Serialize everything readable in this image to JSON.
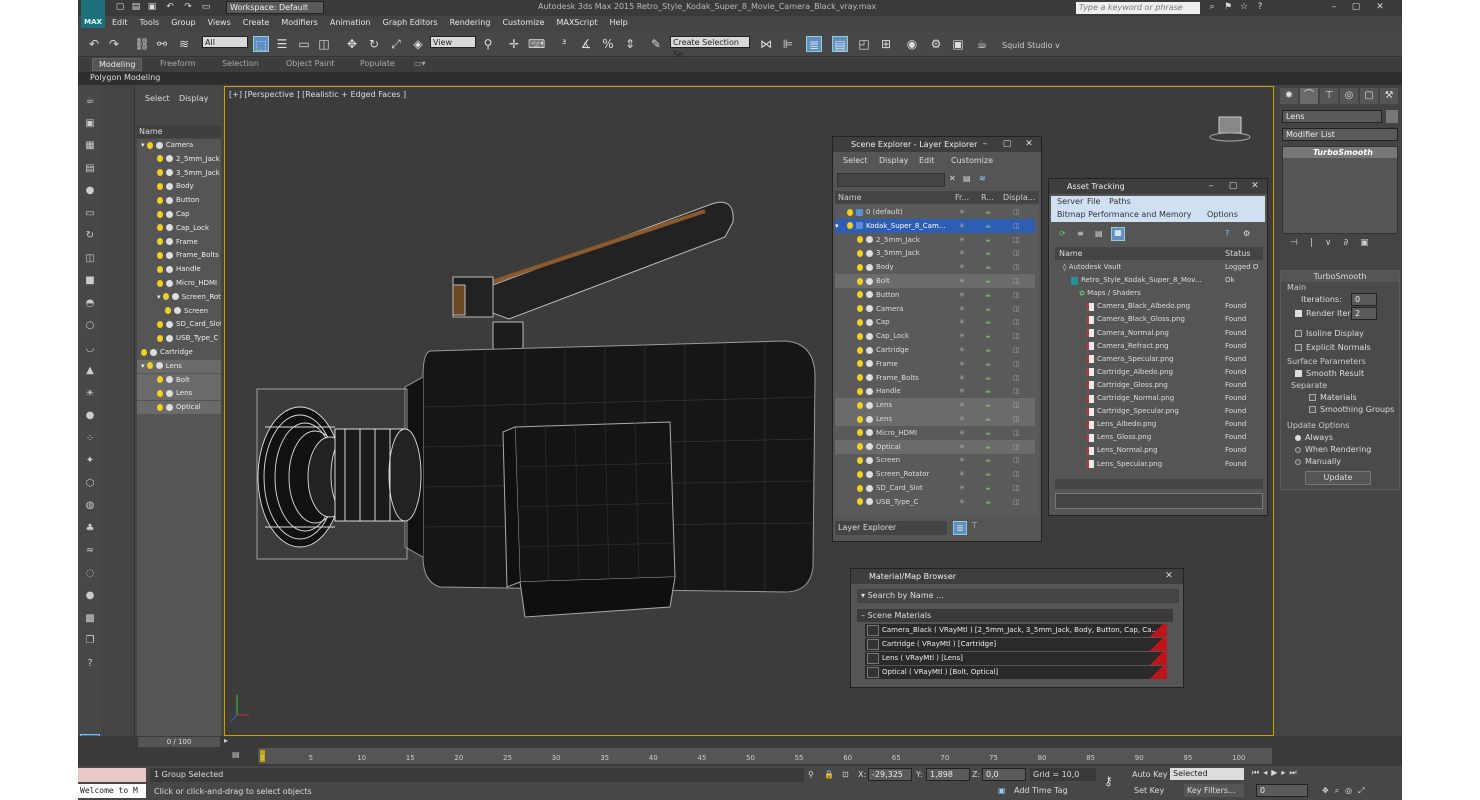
{
  "app": {
    "workspace": "Workspace: Default",
    "title": "Autodesk 3ds Max 2015    Retro_Style_Kodak_Super_8_Movie_Camera_Black_vray.max",
    "search_placeholder": "Type a keyword or phrase",
    "logo": "MAX"
  },
  "menu": [
    "Edit",
    "Tools",
    "Group",
    "Views",
    "Create",
    "Modifiers",
    "Animation",
    "Graph Editors",
    "Rendering",
    "Customize",
    "MAXScript",
    "Help"
  ],
  "toolbar": {
    "filter": "All",
    "view": "View",
    "selection_set": "Create Selection Se",
    "studio": "Squid Studio v"
  },
  "ribbon": {
    "tabs": [
      "Modeling",
      "Freeform",
      "Selection",
      "Object Paint",
      "Populate"
    ],
    "sub": "Polygon Modeling"
  },
  "explorer": {
    "select": "Select",
    "display": "Display",
    "header": "Name",
    "rows": [
      {
        "label": "Camera",
        "kind": "group",
        "indent": 0,
        "sel": false
      },
      {
        "label": "2_5mm_Jack",
        "kind": "obj",
        "indent": 2,
        "sel": false
      },
      {
        "label": "3_5mm_Jack",
        "kind": "obj",
        "indent": 2,
        "sel": false
      },
      {
        "label": "Body",
        "kind": "obj",
        "indent": 2,
        "sel": false
      },
      {
        "label": "Button",
        "kind": "obj",
        "indent": 2,
        "sel": false
      },
      {
        "label": "Cap",
        "kind": "obj",
        "indent": 2,
        "sel": false
      },
      {
        "label": "Cap_Lock",
        "kind": "obj",
        "indent": 2,
        "sel": false
      },
      {
        "label": "Frame",
        "kind": "obj",
        "indent": 2,
        "sel": false
      },
      {
        "label": "Frame_Bolts",
        "kind": "obj",
        "indent": 2,
        "sel": false
      },
      {
        "label": "Handle",
        "kind": "obj",
        "indent": 2,
        "sel": false
      },
      {
        "label": "Micro_HDMI",
        "kind": "obj",
        "indent": 2,
        "sel": false
      },
      {
        "label": "Screen_Rotator",
        "kind": "group",
        "indent": 2,
        "sel": false
      },
      {
        "label": "Screen",
        "kind": "obj",
        "indent": 3,
        "sel": false
      },
      {
        "label": "SD_Card_Slot",
        "kind": "obj",
        "indent": 2,
        "sel": false
      },
      {
        "label": "USB_Type_C",
        "kind": "obj",
        "indent": 2,
        "sel": false
      },
      {
        "label": "Cartridge",
        "kind": "obj",
        "indent": 0,
        "sel": false
      },
      {
        "label": "Lens",
        "kind": "group",
        "indent": 0,
        "sel": true
      },
      {
        "label": "Bolt",
        "kind": "obj",
        "indent": 2,
        "sel": true
      },
      {
        "label": "Lens",
        "kind": "obj",
        "indent": 2,
        "sel": true
      },
      {
        "label": "Optical",
        "kind": "obj",
        "indent": 2,
        "sel": true
      }
    ]
  },
  "viewport": {
    "label": "[+] [Perspective ] [Realistic + Edged Faces ]"
  },
  "scene_explorer": {
    "title": "Scene Explorer - Layer Explorer",
    "menu": [
      "Select",
      "Display",
      "Edit",
      "Customize"
    ],
    "col_name": "Name",
    "col_fr": "Fr...",
    "col_r": "R...",
    "col_disp": "Displa...",
    "rows": [
      {
        "label": "0 (default)",
        "indent": 0,
        "style": ""
      },
      {
        "label": "Kodak_Super_8_Cam...",
        "indent": 0,
        "style": "sel"
      },
      {
        "label": "2_5mm_Jack",
        "indent": 1,
        "style": ""
      },
      {
        "label": "3_5mm_Jack",
        "indent": 1,
        "style": ""
      },
      {
        "label": "Body",
        "indent": 1,
        "style": ""
      },
      {
        "label": "Bolt",
        "indent": 1,
        "style": "hl"
      },
      {
        "label": "Button",
        "indent": 1,
        "style": ""
      },
      {
        "label": "Camera",
        "indent": 1,
        "style": ""
      },
      {
        "label": "Cap",
        "indent": 1,
        "style": ""
      },
      {
        "label": "Cap_Lock",
        "indent": 1,
        "style": ""
      },
      {
        "label": "Cartridge",
        "indent": 1,
        "style": ""
      },
      {
        "label": "Frame",
        "indent": 1,
        "style": ""
      },
      {
        "label": "Frame_Bolts",
        "indent": 1,
        "style": ""
      },
      {
        "label": "Handle",
        "indent": 1,
        "style": ""
      },
      {
        "label": "Lens",
        "indent": 1,
        "style": "hl"
      },
      {
        "label": "Lens",
        "indent": 1,
        "style": "hl"
      },
      {
        "label": "Micro_HDMI",
        "indent": 1,
        "style": ""
      },
      {
        "label": "Optical",
        "indent": 1,
        "style": "hl"
      },
      {
        "label": "Screen",
        "indent": 1,
        "style": ""
      },
      {
        "label": "Screen_Rotator",
        "indent": 1,
        "style": ""
      },
      {
        "label": "SD_Card_Slot",
        "indent": 1,
        "style": ""
      },
      {
        "label": "USB_Type_C",
        "indent": 1,
        "style": ""
      }
    ],
    "footer": "Layer Explorer"
  },
  "asset_tracking": {
    "title": "Asset Tracking",
    "menu1": [
      "Server",
      "File",
      "Paths"
    ],
    "menu2": [
      "Bitmap Performance and Memory",
      "Options"
    ],
    "col_name": "Name",
    "col_status": "Status",
    "rows": [
      {
        "label": "Autodesk Vault",
        "status": "Logged O",
        "indent": 1,
        "type": "vault"
      },
      {
        "label": "Retro_Style_Kodak_Super_8_Mov...",
        "status": "Ok",
        "indent": 2,
        "type": "max"
      },
      {
        "label": "Maps / Shaders",
        "status": "",
        "indent": 3,
        "type": "maps"
      },
      {
        "label": "Camera_Black_Albedo.png",
        "status": "Found",
        "indent": 4,
        "type": "file"
      },
      {
        "label": "Camera_Black_Gloss.png",
        "status": "Found",
        "indent": 4,
        "type": "file"
      },
      {
        "label": "Camera_Normal.png",
        "status": "Found",
        "indent": 4,
        "type": "file"
      },
      {
        "label": "Camera_Refract.png",
        "status": "Found",
        "indent": 4,
        "type": "file"
      },
      {
        "label": "Camera_Specular.png",
        "status": "Found",
        "indent": 4,
        "type": "file"
      },
      {
        "label": "Cartridge_Albedo.png",
        "status": "Found",
        "indent": 4,
        "type": "file"
      },
      {
        "label": "Cartridge_Gloss.png",
        "status": "Found",
        "indent": 4,
        "type": "file"
      },
      {
        "label": "Cartridge_Normal.png",
        "status": "Found",
        "indent": 4,
        "type": "file"
      },
      {
        "label": "Cartridge_Specular.png",
        "status": "Found",
        "indent": 4,
        "type": "file"
      },
      {
        "label": "Lens_Albedo.png",
        "status": "Found",
        "indent": 4,
        "type": "file"
      },
      {
        "label": "Lens_Gloss.png",
        "status": "Found",
        "indent": 4,
        "type": "file"
      },
      {
        "label": "Lens_Normal.png",
        "status": "Found",
        "indent": 4,
        "type": "file"
      },
      {
        "label": "Lens_Specular.png",
        "status": "Found",
        "indent": 4,
        "type": "file"
      }
    ]
  },
  "material_browser": {
    "title": "Material/Map Browser",
    "search": "Search by Name ...",
    "section": "Scene Materials",
    "rows": [
      "Camera_Black  ( VRayMtl )  [2_5mm_Jack, 3_5mm_Jack, Body, Button, Cap, Ca...",
      "Cartridge  ( VRayMtl )  [Cartridge]",
      "Lens  ( VRayMtl )  [Lens]",
      "Optical  ( VRayMtl )  [Bolt, Optical]"
    ]
  },
  "command_panel": {
    "object_name": "Lens",
    "modifier_list": "Modifier List",
    "stack_item": "TurboSmooth",
    "rollout_title": "TurboSmooth",
    "main": "Main",
    "iterations_label": "Iterations:",
    "iterations": "0",
    "render_iters_label": "Render Iters:",
    "render_iters": "2",
    "isoline": "Isoline Display",
    "explicit": "Explicit Normals",
    "surface": "Surface Parameters",
    "smooth_result": "Smooth Result",
    "separate": "Separate",
    "materials": "Materials",
    "smoothing_groups": "Smoothing Groups",
    "update_options": "Update Options",
    "always": "Always",
    "when_rendering": "When Rendering",
    "manually": "Manually",
    "update": "Update"
  },
  "timeline": {
    "frame": "0 / 100",
    "ticks": [
      "0",
      "5",
      "10",
      "15",
      "20",
      "25",
      "30",
      "35",
      "40",
      "45",
      "50",
      "55",
      "60",
      "65",
      "70",
      "75",
      "80",
      "85",
      "90",
      "95",
      "100"
    ]
  },
  "status": {
    "welcome": "Welcome to M",
    "selected": "1 Group Selected",
    "hint": "Click or click-and-drag to select objects",
    "x_label": "X:",
    "x": "-29,325",
    "y_label": "Y:",
    "y": "1,898",
    "z_label": "Z:",
    "z": "0,0",
    "grid": "Grid = 10,0",
    "autokey": "Auto Key",
    "selected_drop": "Selected",
    "setkey": "Set Key",
    "keyfilters": "Key Filters...",
    "addtime": "Add Time Tag",
    "frame_field": "0"
  }
}
